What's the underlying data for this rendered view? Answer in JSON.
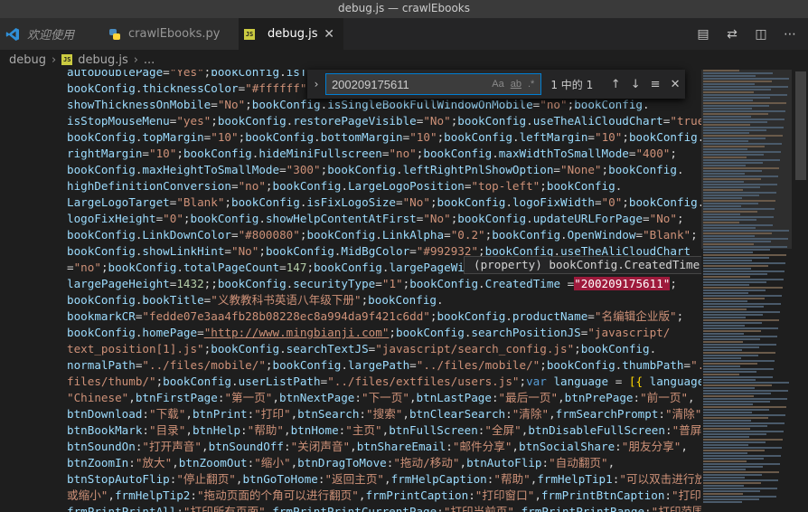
{
  "window": {
    "title": "debug.js — crawlEbooks"
  },
  "tabs": [
    {
      "label": "欢迎使用",
      "icon": "vscode-logo-icon"
    },
    {
      "label": "crawlEbooks.py",
      "icon": "python-icon"
    },
    {
      "label": "debug.js",
      "icon": "js-file-icon",
      "active": true
    }
  ],
  "tab_actions": [
    "open-changes-icon",
    "compare-icon",
    "split-editor-icon",
    "more-actions-icon"
  ],
  "breadcrumb": {
    "folder": "debug",
    "file": "debug.js",
    "more": "..."
  },
  "find": {
    "query": "200209175611",
    "match_case": "Aa",
    "whole_word": "ab",
    "regex": ".*",
    "count": "1 中的 1"
  },
  "hover": {
    "text": "(property) bookConfig.CreatedTime: string"
  },
  "colors": {
    "background": "#1e1e1e",
    "accent": "#007fd4",
    "string": "#ce9178",
    "variable": "#9cdcfe",
    "number": "#b5cea8",
    "keyword": "#569cd6"
  },
  "code_lines": [
    [
      [
        "v",
        "autoDoublePage"
      ],
      [
        "p",
        "="
      ],
      [
        "s",
        "\"Yes\""
      ],
      [
        "p",
        ";"
      ],
      [
        "v",
        "bookConfig"
      ],
      [
        "p",
        "."
      ],
      [
        "v",
        "isThe"
      ]
    ],
    [
      [
        "v",
        "bookConfig"
      ],
      [
        "p",
        "."
      ],
      [
        "v",
        "thicknessColor"
      ],
      [
        "p",
        "="
      ],
      [
        "s",
        "\"#ffffff\""
      ],
      [
        "p",
        ";b"
      ]
    ],
    [
      [
        "v",
        "showThicknessOnMobile"
      ],
      [
        "p",
        "="
      ],
      [
        "s",
        "\"No\""
      ],
      [
        "p",
        ";"
      ],
      [
        "v",
        "bookConfig"
      ],
      [
        "p",
        "."
      ],
      [
        "v",
        "isSingleBookFullWindowOnMobile"
      ],
      [
        "p",
        "="
      ],
      [
        "s",
        "\"no\""
      ],
      [
        "p",
        ";"
      ],
      [
        "v",
        "bookConfig"
      ],
      [
        "p",
        "."
      ]
    ],
    [
      [
        "v",
        "isStopMouseMenu"
      ],
      [
        "p",
        "="
      ],
      [
        "s",
        "\"yes\""
      ],
      [
        "p",
        ";"
      ],
      [
        "v",
        "bookConfig"
      ],
      [
        "p",
        "."
      ],
      [
        "v",
        "restorePageVisible"
      ],
      [
        "p",
        "="
      ],
      [
        "s",
        "\"No\""
      ],
      [
        "p",
        ";"
      ],
      [
        "v",
        "bookConfig"
      ],
      [
        "p",
        "."
      ],
      [
        "v",
        "useTheAliCloudChart"
      ],
      [
        "p",
        "="
      ],
      [
        "s",
        "\"true\""
      ],
      [
        "p",
        ";"
      ]
    ],
    [
      [
        "v",
        "bookConfig"
      ],
      [
        "p",
        "."
      ],
      [
        "v",
        "topMargin"
      ],
      [
        "p",
        "="
      ],
      [
        "s",
        "\"10\""
      ],
      [
        "p",
        ";"
      ],
      [
        "v",
        "bookConfig"
      ],
      [
        "p",
        "."
      ],
      [
        "v",
        "bottomMargin"
      ],
      [
        "p",
        "="
      ],
      [
        "s",
        "\"10\""
      ],
      [
        "p",
        ";"
      ],
      [
        "v",
        "bookConfig"
      ],
      [
        "p",
        "."
      ],
      [
        "v",
        "leftMargin"
      ],
      [
        "p",
        "="
      ],
      [
        "s",
        "\"10\""
      ],
      [
        "p",
        ";"
      ],
      [
        "v",
        "bookConfig"
      ],
      [
        "p",
        "."
      ]
    ],
    [
      [
        "v",
        "rightMargin"
      ],
      [
        "p",
        "="
      ],
      [
        "s",
        "\"10\""
      ],
      [
        "p",
        ";"
      ],
      [
        "v",
        "bookConfig"
      ],
      [
        "p",
        "."
      ],
      [
        "v",
        "hideMiniFullscreen"
      ],
      [
        "p",
        "="
      ],
      [
        "s",
        "\"no\""
      ],
      [
        "p",
        ";"
      ],
      [
        "v",
        "bookConfig"
      ],
      [
        "p",
        "."
      ],
      [
        "v",
        "maxWidthToSmallMode"
      ],
      [
        "p",
        "="
      ],
      [
        "s",
        "\"400\""
      ],
      [
        "p",
        ";"
      ]
    ],
    [
      [
        "v",
        "bookConfig"
      ],
      [
        "p",
        "."
      ],
      [
        "v",
        "maxHeightToSmallMode"
      ],
      [
        "p",
        "="
      ],
      [
        "s",
        "\"300\""
      ],
      [
        "p",
        ";"
      ],
      [
        "v",
        "bookConfig"
      ],
      [
        "p",
        "."
      ],
      [
        "v",
        "leftRightPnlShowOption"
      ],
      [
        "p",
        "="
      ],
      [
        "s",
        "\"None\""
      ],
      [
        "p",
        ";"
      ],
      [
        "v",
        "bookConfig"
      ],
      [
        "p",
        "."
      ]
    ],
    [
      [
        "v",
        "highDefinitionConversion"
      ],
      [
        "p",
        "="
      ],
      [
        "s",
        "\"no\""
      ],
      [
        "p",
        ";"
      ],
      [
        "v",
        "bookConfig"
      ],
      [
        "p",
        "."
      ],
      [
        "v",
        "LargeLogoPosition"
      ],
      [
        "p",
        "="
      ],
      [
        "s",
        "\"top-left\""
      ],
      [
        "p",
        ";"
      ],
      [
        "v",
        "bookConfig"
      ],
      [
        "p",
        "."
      ]
    ],
    [
      [
        "v",
        "LargeLogoTarget"
      ],
      [
        "p",
        "="
      ],
      [
        "s",
        "\"Blank\""
      ],
      [
        "p",
        ";"
      ],
      [
        "v",
        "bookConfig"
      ],
      [
        "p",
        "."
      ],
      [
        "v",
        "isFixLogoSize"
      ],
      [
        "p",
        "="
      ],
      [
        "s",
        "\"No\""
      ],
      [
        "p",
        ";"
      ],
      [
        "v",
        "bookConfig"
      ],
      [
        "p",
        "."
      ],
      [
        "v",
        "logoFixWidth"
      ],
      [
        "p",
        "="
      ],
      [
        "s",
        "\"0\""
      ],
      [
        "p",
        ";"
      ],
      [
        "v",
        "bookConfig"
      ],
      [
        "p",
        "."
      ]
    ],
    [
      [
        "v",
        "logoFixHeight"
      ],
      [
        "p",
        "="
      ],
      [
        "s",
        "\"0\""
      ],
      [
        "p",
        ";"
      ],
      [
        "v",
        "bookConfig"
      ],
      [
        "p",
        "."
      ],
      [
        "v",
        "showHelpContentAtFirst"
      ],
      [
        "p",
        "="
      ],
      [
        "s",
        "\"No\""
      ],
      [
        "p",
        ";"
      ],
      [
        "v",
        "bookConfig"
      ],
      [
        "p",
        "."
      ],
      [
        "v",
        "updateURLForPage"
      ],
      [
        "p",
        "="
      ],
      [
        "s",
        "\"No\""
      ],
      [
        "p",
        ";"
      ]
    ],
    [
      [
        "v",
        "bookConfig"
      ],
      [
        "p",
        "."
      ],
      [
        "v",
        "LinkDownColor"
      ],
      [
        "p",
        "="
      ],
      [
        "s",
        "\"#800080\""
      ],
      [
        "p",
        ";"
      ],
      [
        "v",
        "bookConfig"
      ],
      [
        "p",
        "."
      ],
      [
        "v",
        "LinkAlpha"
      ],
      [
        "p",
        "="
      ],
      [
        "s",
        "\"0.2\""
      ],
      [
        "p",
        ";"
      ],
      [
        "v",
        "bookConfig"
      ],
      [
        "p",
        "."
      ],
      [
        "v",
        "OpenWindow"
      ],
      [
        "p",
        "="
      ],
      [
        "s",
        "\"Blank\""
      ],
      [
        "p",
        ";"
      ]
    ],
    [
      [
        "v",
        "bookConfig"
      ],
      [
        "p",
        "."
      ],
      [
        "v",
        "showLinkHint"
      ],
      [
        "p",
        "="
      ],
      [
        "s",
        "\"No\""
      ],
      [
        "p",
        ";"
      ],
      [
        "v",
        "bookConfig"
      ],
      [
        "p",
        "."
      ],
      [
        "v",
        "MidBgColor"
      ],
      [
        "p",
        "="
      ],
      [
        "s",
        "\"#992932\""
      ],
      [
        "p",
        ";"
      ],
      [
        "v",
        "bookConfig"
      ],
      [
        "p",
        "."
      ],
      [
        "v",
        "useTheAliCloudChart"
      ]
    ],
    [
      [
        "p",
        "="
      ],
      [
        "s",
        "\"no\""
      ],
      [
        "p",
        ";"
      ],
      [
        "v",
        "bookConfig"
      ],
      [
        "p",
        "."
      ],
      [
        "v",
        "totalPageCount"
      ],
      [
        "p",
        "="
      ],
      [
        "n",
        "147"
      ],
      [
        "p",
        ";"
      ],
      [
        "v",
        "bookConfig"
      ],
      [
        "p",
        "."
      ],
      [
        "v",
        "largePageWidth"
      ]
    ],
    [
      [
        "v",
        "largePageHeight"
      ],
      [
        "p",
        "="
      ],
      [
        "n",
        "1432"
      ],
      [
        "p",
        ";;"
      ],
      [
        "v",
        "bookConfig"
      ],
      [
        "p",
        "."
      ],
      [
        "v",
        "securityType"
      ],
      [
        "p",
        "="
      ],
      [
        "s",
        "\"1\""
      ],
      [
        "p",
        ";"
      ],
      [
        "v",
        "bookConfig"
      ],
      [
        "p",
        "."
      ],
      [
        "v",
        "CreatedTime"
      ],
      [
        "p",
        " ="
      ],
      [
        "hl",
        "\"200209175611\""
      ],
      [
        "p",
        ";"
      ]
    ],
    [
      [
        "v",
        "bookConfig"
      ],
      [
        "p",
        "."
      ],
      [
        "v",
        "bookTitle"
      ],
      [
        "p",
        "="
      ],
      [
        "s",
        "\"义教教科书英语八年级下册\""
      ],
      [
        "p",
        ";"
      ],
      [
        "v",
        "bookConfig"
      ],
      [
        "p",
        "."
      ]
    ],
    [
      [
        "v",
        "bookmarkCR"
      ],
      [
        "p",
        "="
      ],
      [
        "s",
        "\"fedde07e3aa4fb28b08228ec8a994da9f421c6dd\""
      ],
      [
        "p",
        ";"
      ],
      [
        "v",
        "bookConfig"
      ],
      [
        "p",
        "."
      ],
      [
        "v",
        "productName"
      ],
      [
        "p",
        "="
      ],
      [
        "s",
        "\"名编辑企业版\""
      ],
      [
        "p",
        ";"
      ]
    ],
    [
      [
        "v",
        "bookConfig"
      ],
      [
        "p",
        "."
      ],
      [
        "v",
        "homePage"
      ],
      [
        "p",
        "="
      ],
      [
        "u",
        "\"http://www.mingbianji.com\""
      ],
      [
        "p",
        ";"
      ],
      [
        "v",
        "bookConfig"
      ],
      [
        "p",
        "."
      ],
      [
        "v",
        "searchPositionJS"
      ],
      [
        "p",
        "="
      ],
      [
        "s",
        "\"javascript/"
      ]
    ],
    [
      [
        "s",
        "text_position[1].js\""
      ],
      [
        "p",
        ";"
      ],
      [
        "v",
        "bookConfig"
      ],
      [
        "p",
        "."
      ],
      [
        "v",
        "searchTextJS"
      ],
      [
        "p",
        "="
      ],
      [
        "s",
        "\"javascript/search_config.js\""
      ],
      [
        "p",
        ";"
      ],
      [
        "v",
        "bookConfig"
      ],
      [
        "p",
        "."
      ]
    ],
    [
      [
        "v",
        "normalPath"
      ],
      [
        "p",
        "="
      ],
      [
        "s",
        "\"../files/mobile/\""
      ],
      [
        "p",
        ";"
      ],
      [
        "v",
        "bookConfig"
      ],
      [
        "p",
        "."
      ],
      [
        "v",
        "largePath"
      ],
      [
        "p",
        "="
      ],
      [
        "s",
        "\"../files/mobile/\""
      ],
      [
        "p",
        ";"
      ],
      [
        "v",
        "bookConfig"
      ],
      [
        "p",
        "."
      ],
      [
        "v",
        "thumbPath"
      ],
      [
        "p",
        "="
      ],
      [
        "s",
        "\"../"
      ]
    ],
    [
      [
        "s",
        "files/thumb/\""
      ],
      [
        "p",
        ";"
      ],
      [
        "v",
        "bookConfig"
      ],
      [
        "p",
        "."
      ],
      [
        "v",
        "userListPath"
      ],
      [
        "p",
        "="
      ],
      [
        "s",
        "\"../files/extfiles/users.js\""
      ],
      [
        "p",
        ";"
      ],
      [
        "k",
        "var"
      ],
      [
        "p",
        " "
      ],
      [
        "v",
        "language"
      ],
      [
        "p",
        " = "
      ],
      [
        "y",
        "[{"
      ],
      [
        "p",
        " "
      ],
      [
        "v",
        "language"
      ],
      [
        "p",
        " :"
      ]
    ],
    [
      [
        "s",
        "\"Chinese\""
      ],
      [
        "p",
        ","
      ],
      [
        "v",
        "btnFirstPage"
      ],
      [
        "p",
        ":"
      ],
      [
        "s",
        "\"第一页\""
      ],
      [
        "p",
        ","
      ],
      [
        "v",
        "btnNextPage"
      ],
      [
        "p",
        ":"
      ],
      [
        "s",
        "\"下一页\""
      ],
      [
        "p",
        ","
      ],
      [
        "v",
        "btnLastPage"
      ],
      [
        "p",
        ":"
      ],
      [
        "s",
        "\"最后一页\""
      ],
      [
        "p",
        ","
      ],
      [
        "v",
        "btnPrePage"
      ],
      [
        "p",
        ":"
      ],
      [
        "s",
        "\"前一页\""
      ],
      [
        "p",
        ","
      ]
    ],
    [
      [
        "v",
        "btnDownload"
      ],
      [
        "p",
        ":"
      ],
      [
        "s",
        "\"下载\""
      ],
      [
        "p",
        ","
      ],
      [
        "v",
        "btnPrint"
      ],
      [
        "p",
        ":"
      ],
      [
        "s",
        "\"打印\""
      ],
      [
        "p",
        ","
      ],
      [
        "v",
        "btnSearch"
      ],
      [
        "p",
        ":"
      ],
      [
        "s",
        "\"搜索\""
      ],
      [
        "p",
        ","
      ],
      [
        "v",
        "btnClearSearch"
      ],
      [
        "p",
        ":"
      ],
      [
        "s",
        "\"清除\""
      ],
      [
        "p",
        ","
      ],
      [
        "v",
        "frmSearchPrompt"
      ],
      [
        "p",
        ":"
      ],
      [
        "s",
        "\"清除\""
      ],
      [
        "p",
        ","
      ]
    ],
    [
      [
        "v",
        "btnBookMark"
      ],
      [
        "p",
        ":"
      ],
      [
        "s",
        "\"目录\""
      ],
      [
        "p",
        ","
      ],
      [
        "v",
        "btnHelp"
      ],
      [
        "p",
        ":"
      ],
      [
        "s",
        "\"帮助\""
      ],
      [
        "p",
        ","
      ],
      [
        "v",
        "btnHome"
      ],
      [
        "p",
        ":"
      ],
      [
        "s",
        "\"主页\""
      ],
      [
        "p",
        ","
      ],
      [
        "v",
        "btnFullScreen"
      ],
      [
        "p",
        ":"
      ],
      [
        "s",
        "\"全屏\""
      ],
      [
        "p",
        ","
      ],
      [
        "v",
        "btnDisableFullScreen"
      ],
      [
        "p",
        ":"
      ],
      [
        "s",
        "\"普屏\""
      ],
      [
        "p",
        ","
      ]
    ],
    [
      [
        "v",
        "btnSoundOn"
      ],
      [
        "p",
        ":"
      ],
      [
        "s",
        "\"打开声音\""
      ],
      [
        "p",
        ","
      ],
      [
        "v",
        "btnSoundOff"
      ],
      [
        "p",
        ":"
      ],
      [
        "s",
        "\"关闭声音\""
      ],
      [
        "p",
        ","
      ],
      [
        "v",
        "btnShareEmail"
      ],
      [
        "p",
        ":"
      ],
      [
        "s",
        "\"邮件分享\""
      ],
      [
        "p",
        ","
      ],
      [
        "v",
        "btnSocialShare"
      ],
      [
        "p",
        ":"
      ],
      [
        "s",
        "\"朋友分享\""
      ],
      [
        "p",
        ","
      ]
    ],
    [
      [
        "v",
        "btnZoomIn"
      ],
      [
        "p",
        ":"
      ],
      [
        "s",
        "\"放大\""
      ],
      [
        "p",
        ","
      ],
      [
        "v",
        "btnZoomOut"
      ],
      [
        "p",
        ":"
      ],
      [
        "s",
        "\"缩小\""
      ],
      [
        "p",
        ","
      ],
      [
        "v",
        "btnDragToMove"
      ],
      [
        "p",
        ":"
      ],
      [
        "s",
        "\"拖动/移动\""
      ],
      [
        "p",
        ","
      ],
      [
        "v",
        "btnAutoFlip"
      ],
      [
        "p",
        ":"
      ],
      [
        "s",
        "\"自动翻页\""
      ],
      [
        "p",
        ","
      ]
    ],
    [
      [
        "v",
        "btnStopAutoFlip"
      ],
      [
        "p",
        ":"
      ],
      [
        "s",
        "\"停止翻页\""
      ],
      [
        "p",
        ","
      ],
      [
        "v",
        "btnGoToHome"
      ],
      [
        "p",
        ":"
      ],
      [
        "s",
        "\"返回主页\""
      ],
      [
        "p",
        ","
      ],
      [
        "v",
        "frmHelpCaption"
      ],
      [
        "p",
        ":"
      ],
      [
        "s",
        "\"帮助\""
      ],
      [
        "p",
        ","
      ],
      [
        "v",
        "frmHelpTip1"
      ],
      [
        "p",
        ":"
      ],
      [
        "s",
        "\"可以双击进行放大"
      ]
    ],
    [
      [
        "s",
        "或缩小\""
      ],
      [
        "p",
        ","
      ],
      [
        "v",
        "frmHelpTip2"
      ],
      [
        "p",
        ":"
      ],
      [
        "s",
        "\"拖动页面的个角可以进行翻页\""
      ],
      [
        "p",
        ","
      ],
      [
        "v",
        "frmPrintCaption"
      ],
      [
        "p",
        ":"
      ],
      [
        "s",
        "\"打印窗口\""
      ],
      [
        "p",
        ","
      ],
      [
        "v",
        "frmPrintBtnCaption"
      ],
      [
        "p",
        ":"
      ],
      [
        "s",
        "\"打印\""
      ],
      [
        "p",
        ","
      ]
    ],
    [
      [
        "v",
        "frmPrintPrintAll"
      ],
      [
        "p",
        ":"
      ],
      [
        "s",
        "\"打印所有页面\""
      ],
      [
        "p",
        ","
      ],
      [
        "v",
        "frmPrintPrintCurrentPage"
      ],
      [
        "p",
        ":"
      ],
      [
        "s",
        "\"打印当前页\""
      ],
      [
        "p",
        ","
      ],
      [
        "v",
        "frmPrintPrintRange"
      ],
      [
        "p",
        ":"
      ],
      [
        "s",
        "\"打印范围"
      ]
    ]
  ]
}
